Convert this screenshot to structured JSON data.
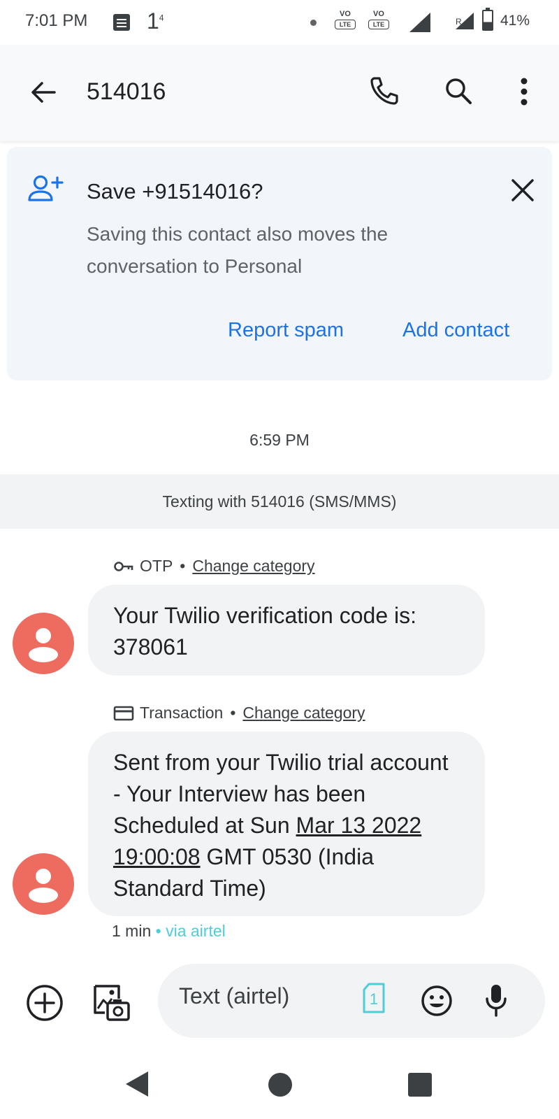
{
  "status_bar": {
    "time": "7:01 PM",
    "one_label": "1",
    "one_sup": "4",
    "volte1": "VO",
    "volte1_sub": "LTE",
    "volte2": "VO",
    "volte2_sub": "LTE",
    "roaming": "R",
    "battery_percent": "41%",
    "battery_level": 0.41
  },
  "app_bar": {
    "title": "514016",
    "back_icon": "arrow-back-icon",
    "call_icon": "phone-icon",
    "search_icon": "search-icon",
    "more_icon": "more-vert-icon"
  },
  "save_card": {
    "title": "Save +91514016?",
    "description": "Saving this contact also moves the conversation to Personal",
    "report_spam": "Report spam",
    "add_contact": "Add contact",
    "accent_color": "#1a73e8"
  },
  "conversation": {
    "timestamp": "6:59 PM",
    "banner": "Texting with 514016 (SMS/MMS)",
    "messages": [
      {
        "category": "OTP",
        "category_icon": "key-icon",
        "change_category": "Change category",
        "text": "Your Twilio verification code is: 378061"
      },
      {
        "category": "Transaction",
        "category_icon": "credit-card-icon",
        "change_category": "Change category",
        "text_part1": "Sent from your Twilio trial account - Your Interview has been Scheduled at Sun ",
        "text_date": "Mar 13 2022 19:00:08",
        "text_part2": " GMT 0530 (India Standard Time)"
      }
    ],
    "meta_time": "1 min",
    "meta_sep": "•",
    "meta_via": "via airtel",
    "avatar_color": "#ee6c5f"
  },
  "compose": {
    "placeholder": "Text (airtel)",
    "sim_label": "1",
    "plus_icon": "add-circle-icon",
    "gallery_icon": "gallery-camera-icon",
    "emoji_icon": "emoji-icon",
    "mic_icon": "mic-icon"
  }
}
